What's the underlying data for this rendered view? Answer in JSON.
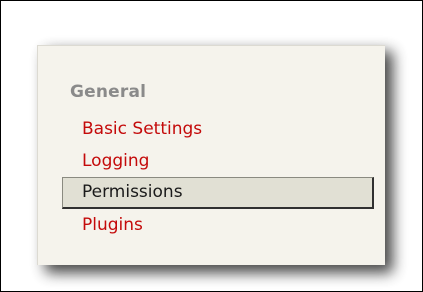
{
  "settings_menu": {
    "group_heading": "General",
    "items": [
      {
        "label": "Basic Settings",
        "selected": false
      },
      {
        "label": "Logging",
        "selected": false
      },
      {
        "label": "Permissions",
        "selected": true
      },
      {
        "label": "Plugins",
        "selected": false
      }
    ]
  },
  "colors": {
    "link": "#c40a0a",
    "heading": "#8a8a8a",
    "selected_background": "#e1e0d4",
    "panel_background": "#f5f3ec"
  }
}
